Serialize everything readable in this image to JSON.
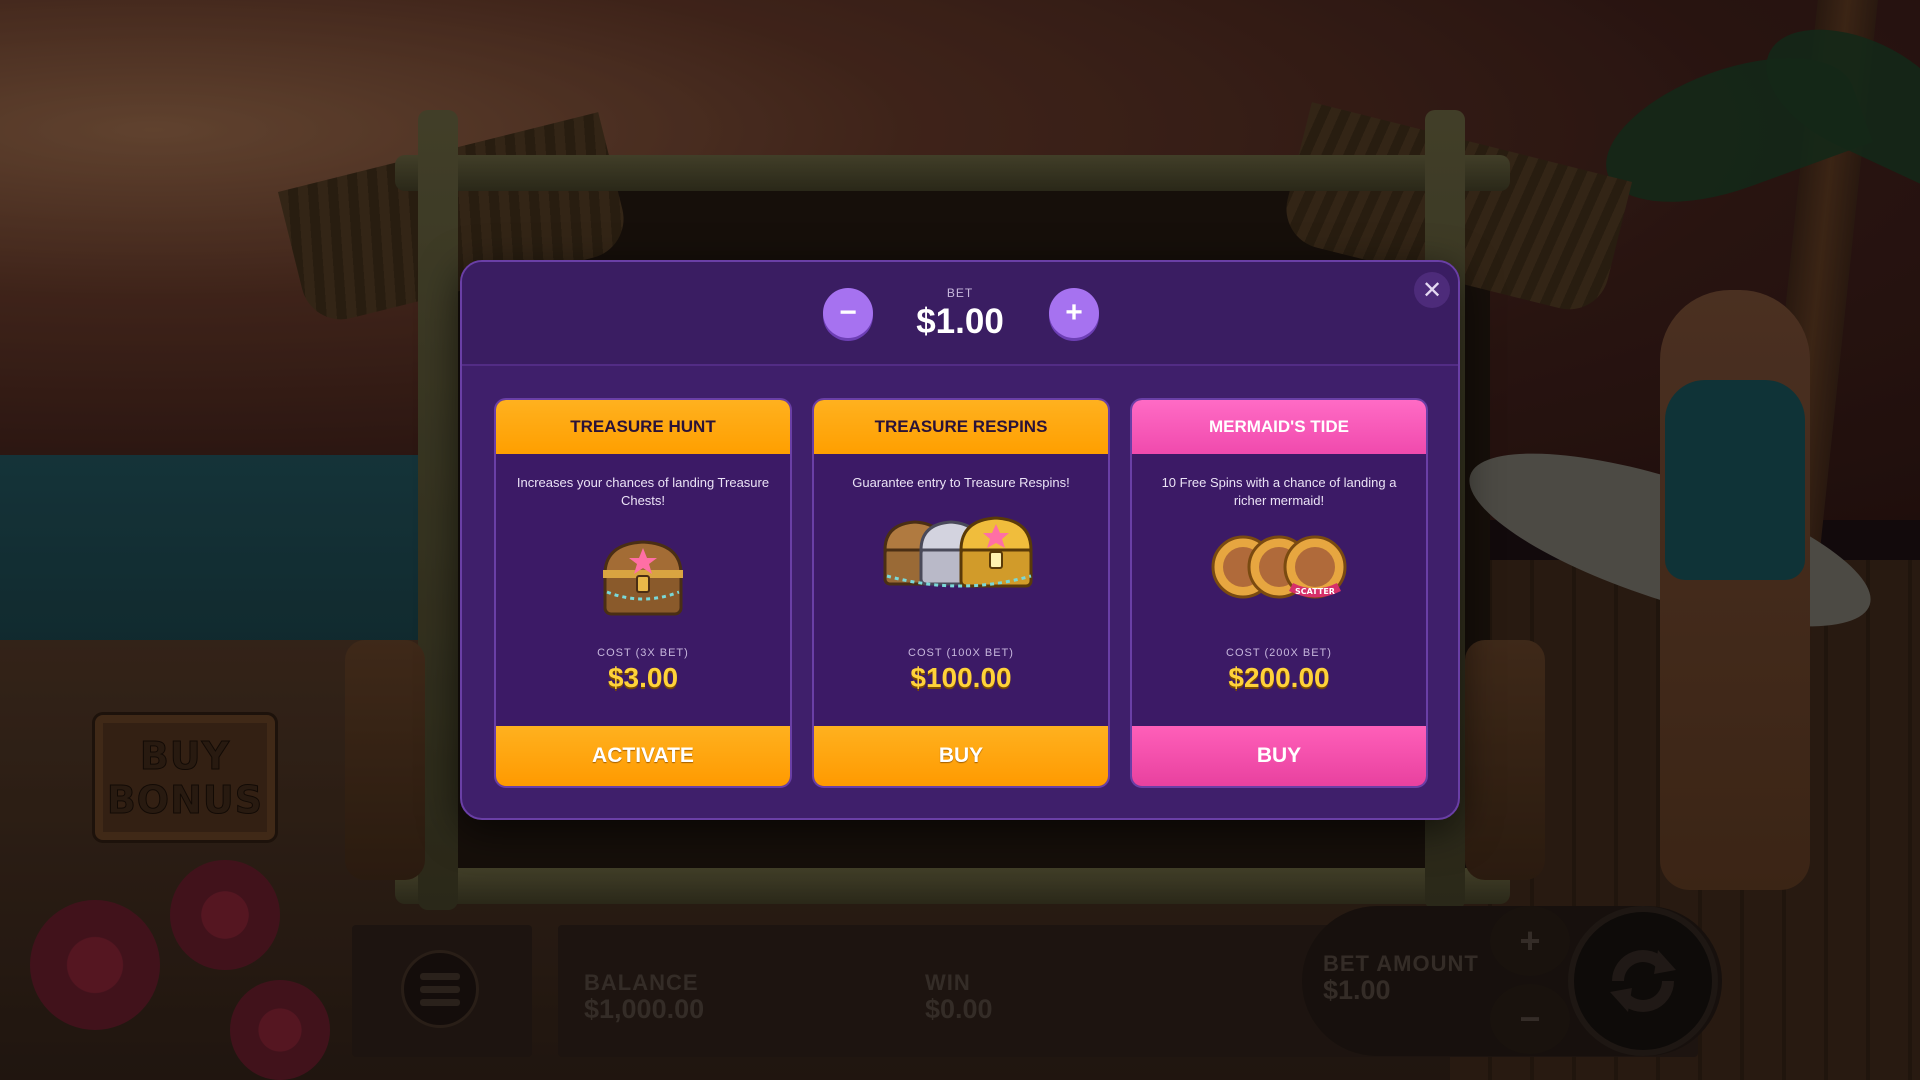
{
  "background": {
    "buy_bonus_sign": [
      "BUY",
      "BONUS"
    ]
  },
  "hud": {
    "balance_label": "BALANCE",
    "balance_value": "$1,000.00",
    "win_label": "WIN",
    "win_value": "$0.00",
    "bet_amount_label": "BET AMOUNT",
    "bet_amount_value": "$1.00",
    "increase_symbol": "+",
    "decrease_symbol": "−",
    "menu_icon": "hamburger-menu-icon",
    "spin_icon": "spin-arrows-icon"
  },
  "modal": {
    "bet_caption": "BET",
    "bet_value": "$1.00",
    "decrease_symbol": "−",
    "increase_symbol": "+",
    "close_symbol": "✕",
    "cards": [
      {
        "title": "TREASURE HUNT",
        "description": "Increases your chances of landing Treasure Chests!",
        "cost_caption": "COST (3X BET)",
        "cost_value": "$3.00",
        "button_label": "ACTIVATE",
        "theme_color": "#ffa400",
        "art_icon": "treasure-chest-icon"
      },
      {
        "title": "TREASURE RESPINS",
        "description": "Guarantee entry to Treasure Respins!",
        "cost_caption": "COST (100X BET)",
        "cost_value": "$100.00",
        "button_label": "BUY",
        "theme_color": "#ffa400",
        "art_icon": "triple-treasure-chest-icon"
      },
      {
        "title": "MERMAID'S TIDE",
        "description": "10 Free Spins with a chance of landing a richer mermaid!",
        "cost_caption": "COST (200X BET)",
        "cost_value": "$200.00",
        "button_label": "BUY",
        "theme_color": "#f050ad",
        "art_icon": "scatter-coins-icon",
        "art_text": "SCATTER"
      }
    ]
  },
  "colors": {
    "modal_bg": "#3f1f6b",
    "accent_purple": "#a672f0",
    "cost_gold": "#ffd23a"
  }
}
